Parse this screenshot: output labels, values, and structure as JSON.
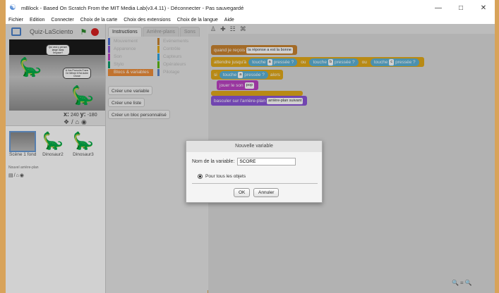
{
  "window": {
    "title": "mBlock - Based On Scratch From the MIT Media Lab(v3.4.11) - Déconnecter - Pas sauvegardé"
  },
  "menu": [
    "Fichier",
    "Edition",
    "Connecter",
    "Choix de la carte",
    "Choix des extensions",
    "Choix de la langue",
    "Aide"
  ],
  "project": {
    "name": "Quiz-LaSciento"
  },
  "stage": {
    "bubble1": "Qui veut y penser lange dans l'espace?",
    "bubble2": "A Vos Pouvoirs Franc Ce Même Il Est Autre Chose",
    "x_label": "x:",
    "x_value": "240",
    "y_label": "y:",
    "y_value": "-180"
  },
  "sprites": {
    "items": [
      {
        "name": "Scène 1 fond"
      },
      {
        "name": "Dinosaur2"
      },
      {
        "name": "Dinosaur3"
      }
    ],
    "backdrop_label": "Nouvel arrière-plan"
  },
  "palette": {
    "tabs": [
      "Instructions",
      "Arrière-plans",
      "Sons"
    ],
    "categories_left": [
      "Mouvement",
      "Apparence",
      "Son",
      "Stylo",
      "Blocs & variables"
    ],
    "categories_right": [
      "Evénements",
      "Contrôle",
      "Capteurs",
      "Opérateurs",
      "Pilotage"
    ],
    "buttons": [
      "Créer une variable",
      "Créer une liste",
      "Créer un bloc personnalisé"
    ]
  },
  "scripts": {
    "hat_text": "quand je reçois",
    "hat_value": "la réponse a est la bonne",
    "wait_text": "attendre jusqu'à",
    "touch": "touche",
    "key_a": "a",
    "key_b": "b",
    "key_c": "c",
    "pressed": "pressée ?",
    "or": "ou",
    "if_text": "si",
    "then_text": "alors",
    "play_text": "jouer le son",
    "sound_value": "pop",
    "switch_text": "basculer sur l'arrière-plan",
    "switch_value": "arrière-plan suivant"
  },
  "dialog": {
    "title": "Nouvelle variable",
    "field_label": "Nom de la variable:",
    "field_value": "SCORE",
    "radio_label": "Pour tous les objets",
    "ok": "OK",
    "cancel": "Annuler"
  },
  "colors": {
    "accent": "#d8a35a",
    "blocks_var": "#ec8d3a",
    "sensing": "#5cb1d6"
  }
}
